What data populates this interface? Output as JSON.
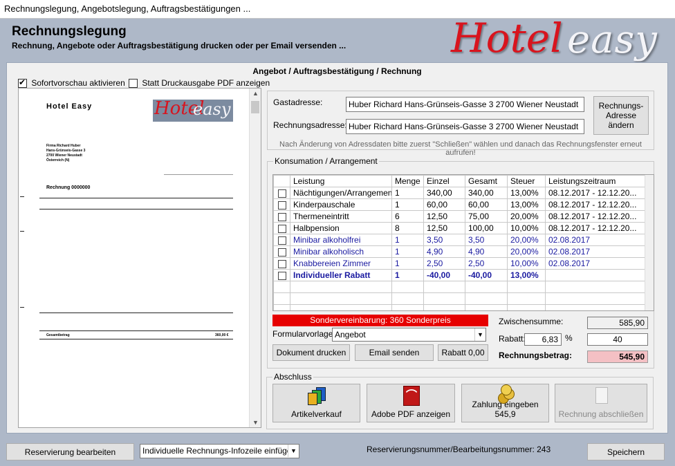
{
  "window": {
    "title": "Rechnungslegung, Angebotslegung, Auftragsbestätigungen ..."
  },
  "header": {
    "title": "Rechnungslegung",
    "subtitle": "Rechnung, Angebote oder Auftragsbestätigung drucken oder per Email versenden ...",
    "logo_word1": "Hotel",
    "logo_word2": "easy"
  },
  "panel": {
    "title": "Angebot / Auftragsbestätigung / Rechnung",
    "preview_checkbox": {
      "label": "Sofortvorschau aktivieren",
      "checked": true
    },
    "pdf_checkbox": {
      "label": "Statt Druckausgabe PDF anzeigen",
      "checked": false
    }
  },
  "preview": {
    "company": "Hotel   Easy",
    "logo_word1": "Hotel",
    "logo_word2": "easy",
    "recipient": [
      "Firma  Richard  Huber",
      "Hans-Grünseis-Gasse  3",
      "2700  Wiener  Neustadt",
      "Österreich  (N)"
    ],
    "doc_title": "Rechnung  0000000",
    "total_label": "Gesamtbetrag",
    "total_value": "360,00 €"
  },
  "address": {
    "guest_label": "Gastadresse:",
    "guest_value": "Huber Richard  Hans-Grünseis-Gasse 3 2700 Wiener Neustadt",
    "invoice_label": "Rechnungsadresse:",
    "invoice_value": "Huber Richard  Hans-Grünseis-Gasse 3 2700 Wiener Neustadt",
    "change_button": "Rechnungs-Adresse ändern",
    "hint": "Nach Änderung von Adressdaten bitte zuerst \"Schließen\" wählen und danach das Rechnungsfenster erneut aufrufen!"
  },
  "consumption": {
    "title": "Konsumation / Arrangement",
    "columns": [
      "Leistung",
      "Menge",
      "Einzel",
      "Gesamt",
      "Steuer",
      "Leistungszeitraum"
    ],
    "rows": [
      {
        "leistung": "Nächtigungen/Arrangement",
        "menge": "1",
        "einzel": "340,00",
        "gesamt": "340,00",
        "steuer": "13,00%",
        "zeitraum": "08.12.2017 - 12.12.20..."
      },
      {
        "leistung": "Kinderpauschale",
        "menge": "1",
        "einzel": "60,00",
        "gesamt": "60,00",
        "steuer": "13,00%",
        "zeitraum": "08.12.2017 - 12.12.20..."
      },
      {
        "leistung": "Thermeneintritt",
        "menge": "6",
        "einzel": "12,50",
        "gesamt": "75,00",
        "steuer": "20,00%",
        "zeitraum": "08.12.2017 - 12.12.20..."
      },
      {
        "leistung": "Halbpension",
        "menge": "8",
        "einzel": "12,50",
        "gesamt": "100,00",
        "steuer": "10,00%",
        "zeitraum": "08.12.2017 - 12.12.20..."
      },
      {
        "leistung": "Minibar alkoholfrei",
        "menge": "1",
        "einzel": "3,50",
        "gesamt": "3,50",
        "steuer": "20,00%",
        "zeitraum": "02.08.2017"
      },
      {
        "leistung": "Minibar alkoholisch",
        "menge": "1",
        "einzel": "4,90",
        "gesamt": "4,90",
        "steuer": "20,00%",
        "zeitraum": "02.08.2017"
      },
      {
        "leistung": "Knabbereien Zimmer",
        "menge": "1",
        "einzel": "2,50",
        "gesamt": "2,50",
        "steuer": "10,00%",
        "zeitraum": "02.08.2017"
      },
      {
        "leistung": "Individueller Rabatt",
        "menge": "1",
        "einzel": "-40,00",
        "gesamt": "-40,00",
        "steuer": "13,00%",
        "zeitraum": ""
      }
    ],
    "special_agreement": "Sondervereinbarung: 360 Sonderpreis",
    "template_label": "Formularvorlage:",
    "template_value": "Angebot",
    "print_button": "Dokument drucken",
    "email_button": "Email senden",
    "discount_button": "Rabatt 0,00",
    "subtotal_label": "Zwischensumme:",
    "subtotal_value": "585,90",
    "discount_label": "Rabatt:",
    "discount_percent": "6,83",
    "percent_sign": "%",
    "discount_value": "40",
    "total_label": "Rechnungsbetrag:",
    "total_value": "545,90",
    "colors": {
      "red_bar": "#e60000",
      "total_bg": "#f4c0c4",
      "blue_rows": "#1a1aa0"
    }
  },
  "closing": {
    "title": "Abschluss",
    "buttons": [
      {
        "label": "Artikelverkauf",
        "icon": "stacked-folders-icon"
      },
      {
        "label": "Adobe PDF anzeigen",
        "icon": "pdf-icon"
      },
      {
        "label": "Zahlung eingeben 545,9",
        "icon": "coins-icon"
      },
      {
        "label": "Rechnung abschließen",
        "icon": "document-icon"
      }
    ]
  },
  "footer": {
    "edit_reservation": "Reservierung bearbeiten",
    "info_line_value": "Individuelle Rechnungs-Infozeile einfügen",
    "reservation_number": "Reservierungsnummer/Bearbeitungsnummer: 243",
    "save_button": "Speichern"
  }
}
